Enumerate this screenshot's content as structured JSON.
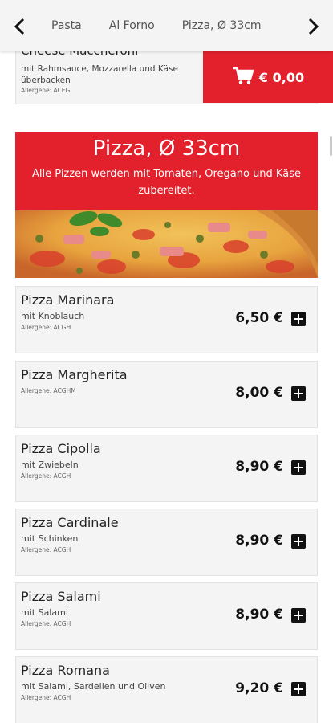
{
  "nav": {
    "tabs": [
      "Pasta",
      "Al Forno",
      "Pizza, Ø 33cm"
    ],
    "prev_icon": "chevron-left-icon",
    "next_icon": "chevron-right-icon"
  },
  "previous_item": {
    "name": "Cheese Maccheroni",
    "description": "mit Rahmsauce, Mozzarella und Käse überbacken",
    "allergens": "Allergene: ACEG"
  },
  "cart": {
    "icon": "cart-icon",
    "amount": "€ 0,00"
  },
  "section": {
    "title": "Pizza, Ø 33cm",
    "description": "Alle Pizzen werden mit Tomaten, Oregano und Käse zubereitet."
  },
  "items": [
    {
      "name": "Pizza Marinara",
      "description": "mit Knoblauch",
      "allergens": "Allergene: ACGH",
      "price": "6,50 €"
    },
    {
      "name": "Pizza Margherita",
      "description": "",
      "allergens": "Allergene: ACGHM",
      "price": "8,00 €"
    },
    {
      "name": "Pizza Cipolla",
      "description": "mit Zwiebeln",
      "allergens": "Allergene: ACGH",
      "price": "8,90 €"
    },
    {
      "name": "Pizza Cardinale",
      "description": "mit Schinken",
      "allergens": "Allergene: ACGH",
      "price": "8,90 €"
    },
    {
      "name": "Pizza Salami",
      "description": "mit Salami",
      "allergens": "Allergene: ACGH",
      "price": "8,90 €"
    },
    {
      "name": "Pizza Romana",
      "description": "mit Salami, Sardellen und Oliven",
      "allergens": "Allergene: ACGH",
      "price": "9,20 €"
    }
  ],
  "colors": {
    "accent": "#e3212c",
    "card": "#f4f4f4"
  }
}
